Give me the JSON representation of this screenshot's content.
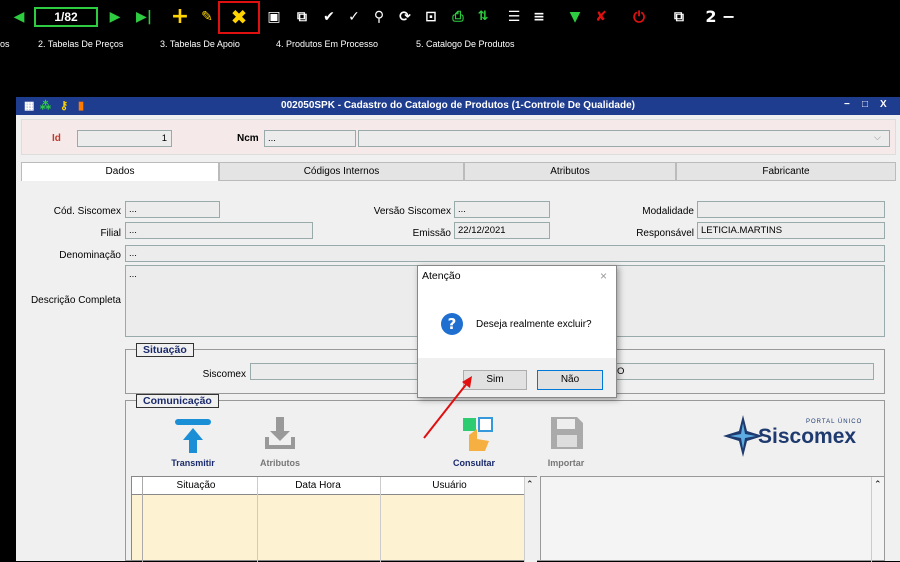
{
  "toolbar": {
    "record_counter": "1/82",
    "item_count": "2",
    "colors": {
      "accent_green": "#2ecc40",
      "delete_yellow": "#ffd400",
      "highlight_red": "#e01010"
    }
  },
  "menu": {
    "items": [
      "os",
      "2. Tabelas De Preços",
      "3. Tabelas De Apoio",
      "4. Produtos Em Processo",
      "5. Catalogo De Produtos"
    ]
  },
  "window": {
    "title": "002050SPK - Cadastro do Catalogo de Produtos (1-Controle De Qualidade)",
    "controls": [
      "−",
      "□",
      "X"
    ]
  },
  "header": {
    "id_label": "Id",
    "id_value": "1",
    "ncm_label": "Ncm",
    "ncm_value": "..."
  },
  "tabs": [
    "Dados",
    "Códigos Internos",
    "Atributos",
    "Fabricante"
  ],
  "form": {
    "cod_siscomex_label": "Cód. Siscomex",
    "cod_siscomex_value": "...",
    "versao_label": "Versão Siscomex",
    "versao_value": "...",
    "modalidade_label": "Modalidade",
    "modalidade_value": "",
    "filial_label": "Filial",
    "filial_value": "...",
    "emissao_label": "Emissão",
    "emissao_value": "22/12/2021",
    "responsavel_label": "Responsável",
    "responsavel_value": "LETICIA.MARTINS",
    "denominacao_label": "Denominação",
    "denominacao_value": "...",
    "descricao_label": "Descrição Completa",
    "descricao_value": "..."
  },
  "situacao": {
    "title": "Situação",
    "siscomex_label": "Siscomex",
    "right_value_tail": "O"
  },
  "comunicacao": {
    "title": "Comunicação",
    "actions": [
      {
        "label": "Transmitir",
        "icon": "upload-icon"
      },
      {
        "label": "Atributos",
        "icon": "download-icon"
      },
      {
        "label": "Consultar",
        "icon": "touch-icon"
      },
      {
        "label": "Importar",
        "icon": "floppy-icon"
      }
    ],
    "logo_small": "PORTAL ÚNICO",
    "logo_text": "Siscomex"
  },
  "grid": {
    "columns": [
      "Situação",
      "Data Hora",
      "Usuário"
    ]
  },
  "dialog": {
    "title": "Atenção",
    "message": "Deseja realmente excluir?",
    "icon": "question-icon",
    "yes_label": "Sim",
    "no_label": "Não"
  }
}
